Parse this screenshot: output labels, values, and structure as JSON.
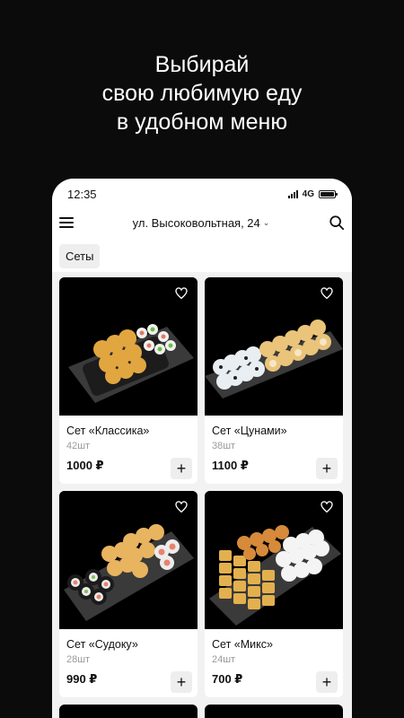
{
  "promo": {
    "line1": "Выбирай",
    "line2": "свою любимую еду",
    "line3": "в удобном меню"
  },
  "status_bar": {
    "time": "12:35",
    "network": "4G",
    "icons": [
      "signal-icon",
      "battery-icon"
    ]
  },
  "header": {
    "address": "ул. Высоковольтная, 24",
    "icons": [
      "menu-icon",
      "chevron-down-icon",
      "search-icon"
    ]
  },
  "category_chip": "Сеты",
  "products": [
    {
      "name": "Сет «Классика»",
      "qty": "42шт",
      "price": "1000 ₽"
    },
    {
      "name": "Сет «Цунами»",
      "qty": "38шт",
      "price": "1100 ₽"
    },
    {
      "name": "Сет «Судоку»",
      "qty": "28шт",
      "price": "990 ₽"
    },
    {
      "name": "Сет «Микс»",
      "qty": "24шт",
      "price": "700 ₽"
    }
  ],
  "add_label": "+",
  "colors": {
    "background": "#0b0b0b",
    "screen": "#f2f2f2",
    "card": "#ffffff",
    "button": "#eeeeee",
    "muted_text": "#9a9a9a"
  }
}
